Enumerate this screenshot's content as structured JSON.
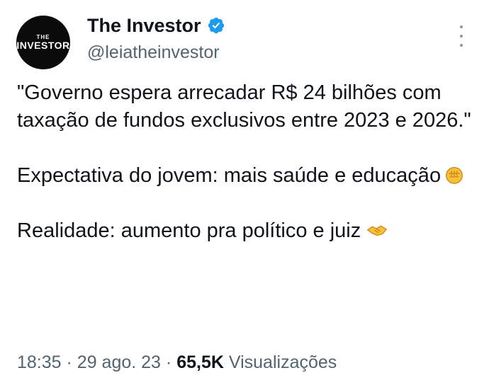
{
  "author": {
    "avatar_text_small": "THE",
    "avatar_text_big": "INVESTOR",
    "name": "The Investor",
    "handle": "@leiatheinvestor",
    "verified_icon": "verified-badge-icon"
  },
  "more_icon": "more-vertical-icon",
  "tweet": {
    "lines_1": "\"Governo espera arrecadar R$ 24 bilhões com taxação de fundos exclusivos entre 2023 e 2026.\"",
    "lines_2": "Expectativa do jovem: mais saúde e educação",
    "emoji_2": "fist-emoji-icon",
    "lines_3": "Realidade: aumento pra político e juiz",
    "emoji_3": "handshake-emoji-icon"
  },
  "meta": {
    "time": "18:35",
    "date": "29 ago. 23",
    "views_count": "65,5K",
    "views_label": "Visualizações",
    "separator": "·"
  },
  "colors": {
    "text": "#0f1419",
    "secondary": "#536471",
    "verified": "#1d9bf0"
  }
}
